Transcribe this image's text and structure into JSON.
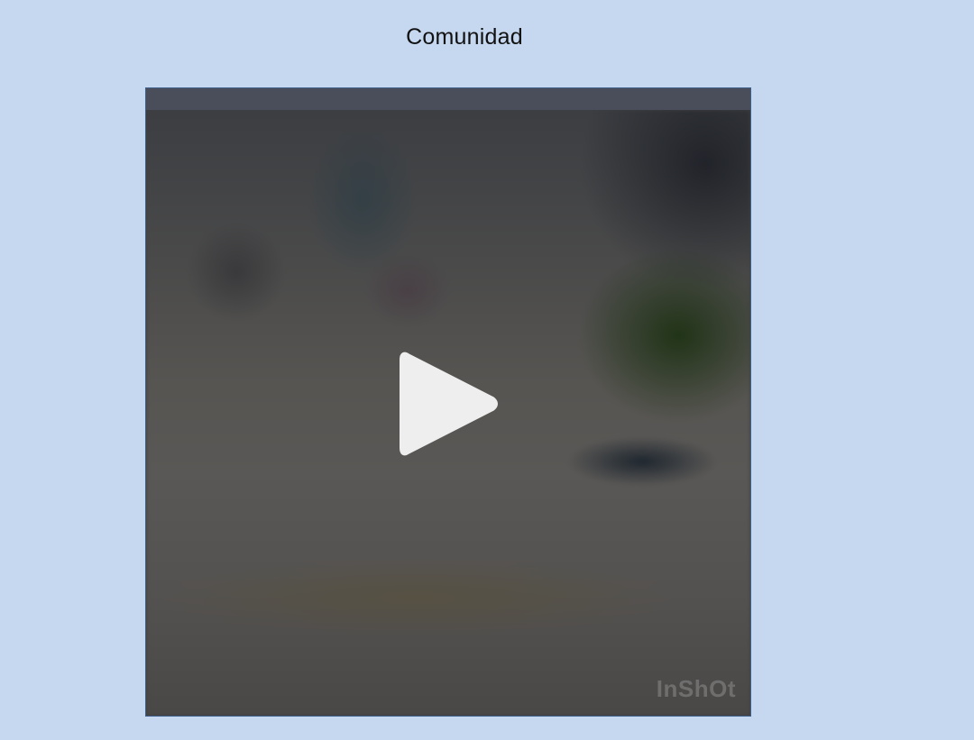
{
  "page": {
    "title": "Comunidad"
  },
  "video": {
    "watermark": "InShOt",
    "play_icon": "play-icon",
    "colors": {
      "background": "#c5d8f0",
      "frame_border": "#3f5f8c",
      "topbar": "#4a4e5a",
      "play_fill": "#eeeeee"
    }
  }
}
